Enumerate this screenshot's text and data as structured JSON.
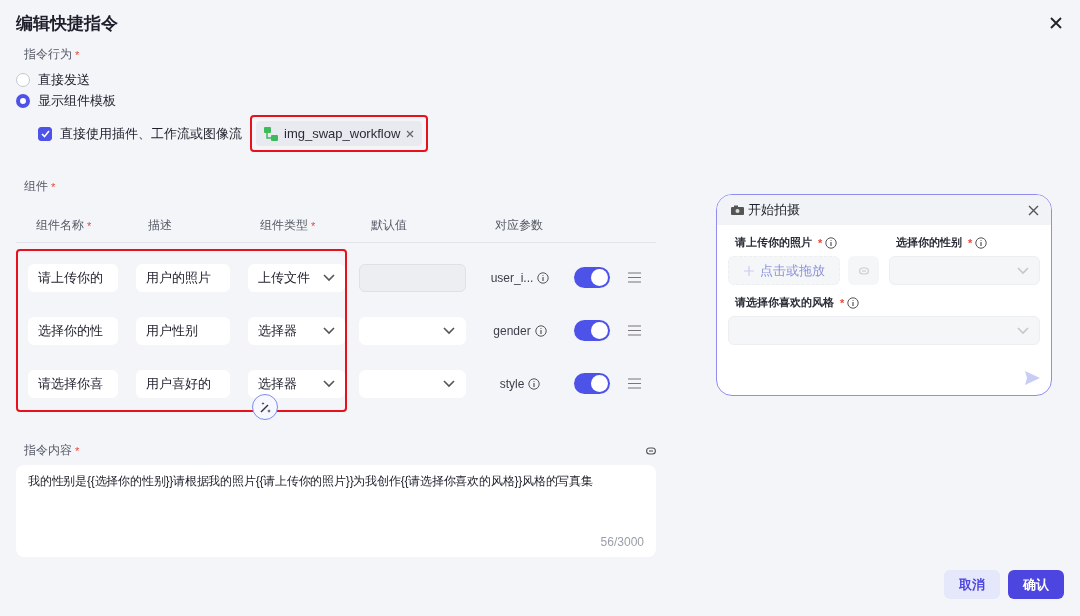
{
  "dialog": {
    "title": "编辑快捷指令"
  },
  "behavior": {
    "label": "指令行为",
    "mark": "*",
    "options": [
      {
        "label": "直接发送",
        "selected": false
      },
      {
        "label": "显示组件模板",
        "selected": true
      }
    ],
    "direct_use": {
      "label": "直接使用插件、工作流或图像流",
      "checked": true
    },
    "workflow_tag": {
      "label": "img_swap_workflow",
      "highlighted": true
    }
  },
  "components": {
    "label": "组件",
    "mark": "*",
    "highlighted": true,
    "columns": [
      {
        "label": "组件名称",
        "mark": "*"
      },
      {
        "label": "描述"
      },
      {
        "label": "组件类型",
        "mark": "*"
      },
      {
        "label": "默认值"
      },
      {
        "label": "对应参数"
      }
    ],
    "rows": [
      {
        "name": "请上传你的",
        "description": "用户的照片",
        "type": "上传文件",
        "default": {
          "kind": "disabled"
        },
        "param": "user_i...",
        "enabled": true
      },
      {
        "name": "选择你的性",
        "description": "用户性别",
        "type": "选择器",
        "default": {
          "kind": "select"
        },
        "param": "gender",
        "enabled": true
      },
      {
        "name": "请选择你喜",
        "description": "用户喜好的",
        "type": "选择器",
        "default": {
          "kind": "select"
        },
        "param": "style",
        "enabled": true
      }
    ]
  },
  "content": {
    "label": "指令内容",
    "mark": "*",
    "value": "我的性别是{{选择你的性别}}请根据我的照片{{请上传你的照片}}为我创作{{请选择你喜欢的风格}}风格的写真集",
    "counter": "56/3000"
  },
  "preview": {
    "title": "开始拍摄",
    "rows": [
      [
        {
          "label": "请上传你的照片",
          "mark": "*",
          "kind": "upload",
          "placeholder": "点击或拖放"
        },
        {
          "label": "选择你的性别",
          "mark": "*",
          "kind": "select"
        }
      ],
      [
        {
          "label": "请选择你喜欢的风格",
          "mark": "*",
          "kind": "select"
        }
      ]
    ]
  },
  "buttons": [
    {
      "label": "取消",
      "kind": "secondary"
    },
    {
      "label": "确认",
      "kind": "primary"
    }
  ]
}
